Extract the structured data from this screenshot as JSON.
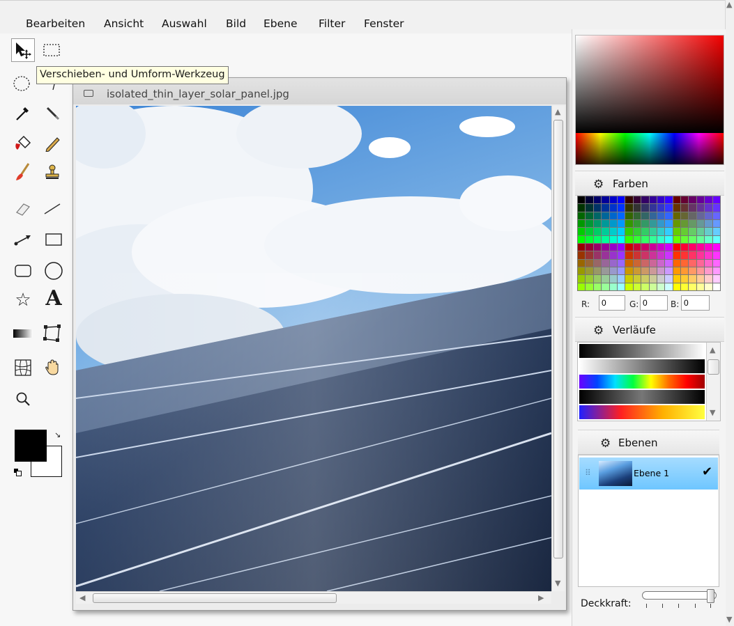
{
  "menu": {
    "items": [
      "Bearbeiten",
      "Ansicht",
      "Auswahl",
      "Bild",
      "Ebene",
      "Filter",
      "Fenster"
    ]
  },
  "tooltip": {
    "text": "Verschieben- und Umform-Werkzeug"
  },
  "image_window": {
    "title": "isolated_thin_layer_solar_panel.jpg"
  },
  "colors": {
    "foreground": "#000000",
    "background": "#ffffff",
    "accent_selection": "#7ccaff"
  },
  "panels": {
    "colors_title": "Farben",
    "gradients_title": "Verläufe",
    "layers_title": "Ebenen"
  },
  "rgb": {
    "r_label": "R:",
    "g_label": "G:",
    "b_label": "B:",
    "r": "0",
    "g": "0",
    "b": "0"
  },
  "layers": {
    "items": [
      {
        "name": "Ebene 1",
        "visible": "✔"
      }
    ]
  },
  "opacity": {
    "label": "Deckkraft:",
    "value_fraction": 1.0
  },
  "tools": [
    "move-icon",
    "rect-select-icon",
    "ellipse-select-icon",
    "lasso-icon",
    "eyedropper-icon",
    "smudge-icon",
    "fill-bucket-icon",
    "pencil-icon",
    "brush-icon",
    "stamp-icon",
    "eraser-icon",
    "line-icon",
    "arrow-line-icon",
    "rectangle-icon",
    "rounded-rect-icon",
    "ellipse-icon",
    "star-icon",
    "text-icon",
    "gradient-icon",
    "transform-icon",
    "warp-icon",
    "hand-icon",
    "zoom-icon"
  ],
  "tool_glyphs": {
    "text_tool": "A",
    "star_tool": "☆",
    "zoom_tool": "⚲"
  }
}
